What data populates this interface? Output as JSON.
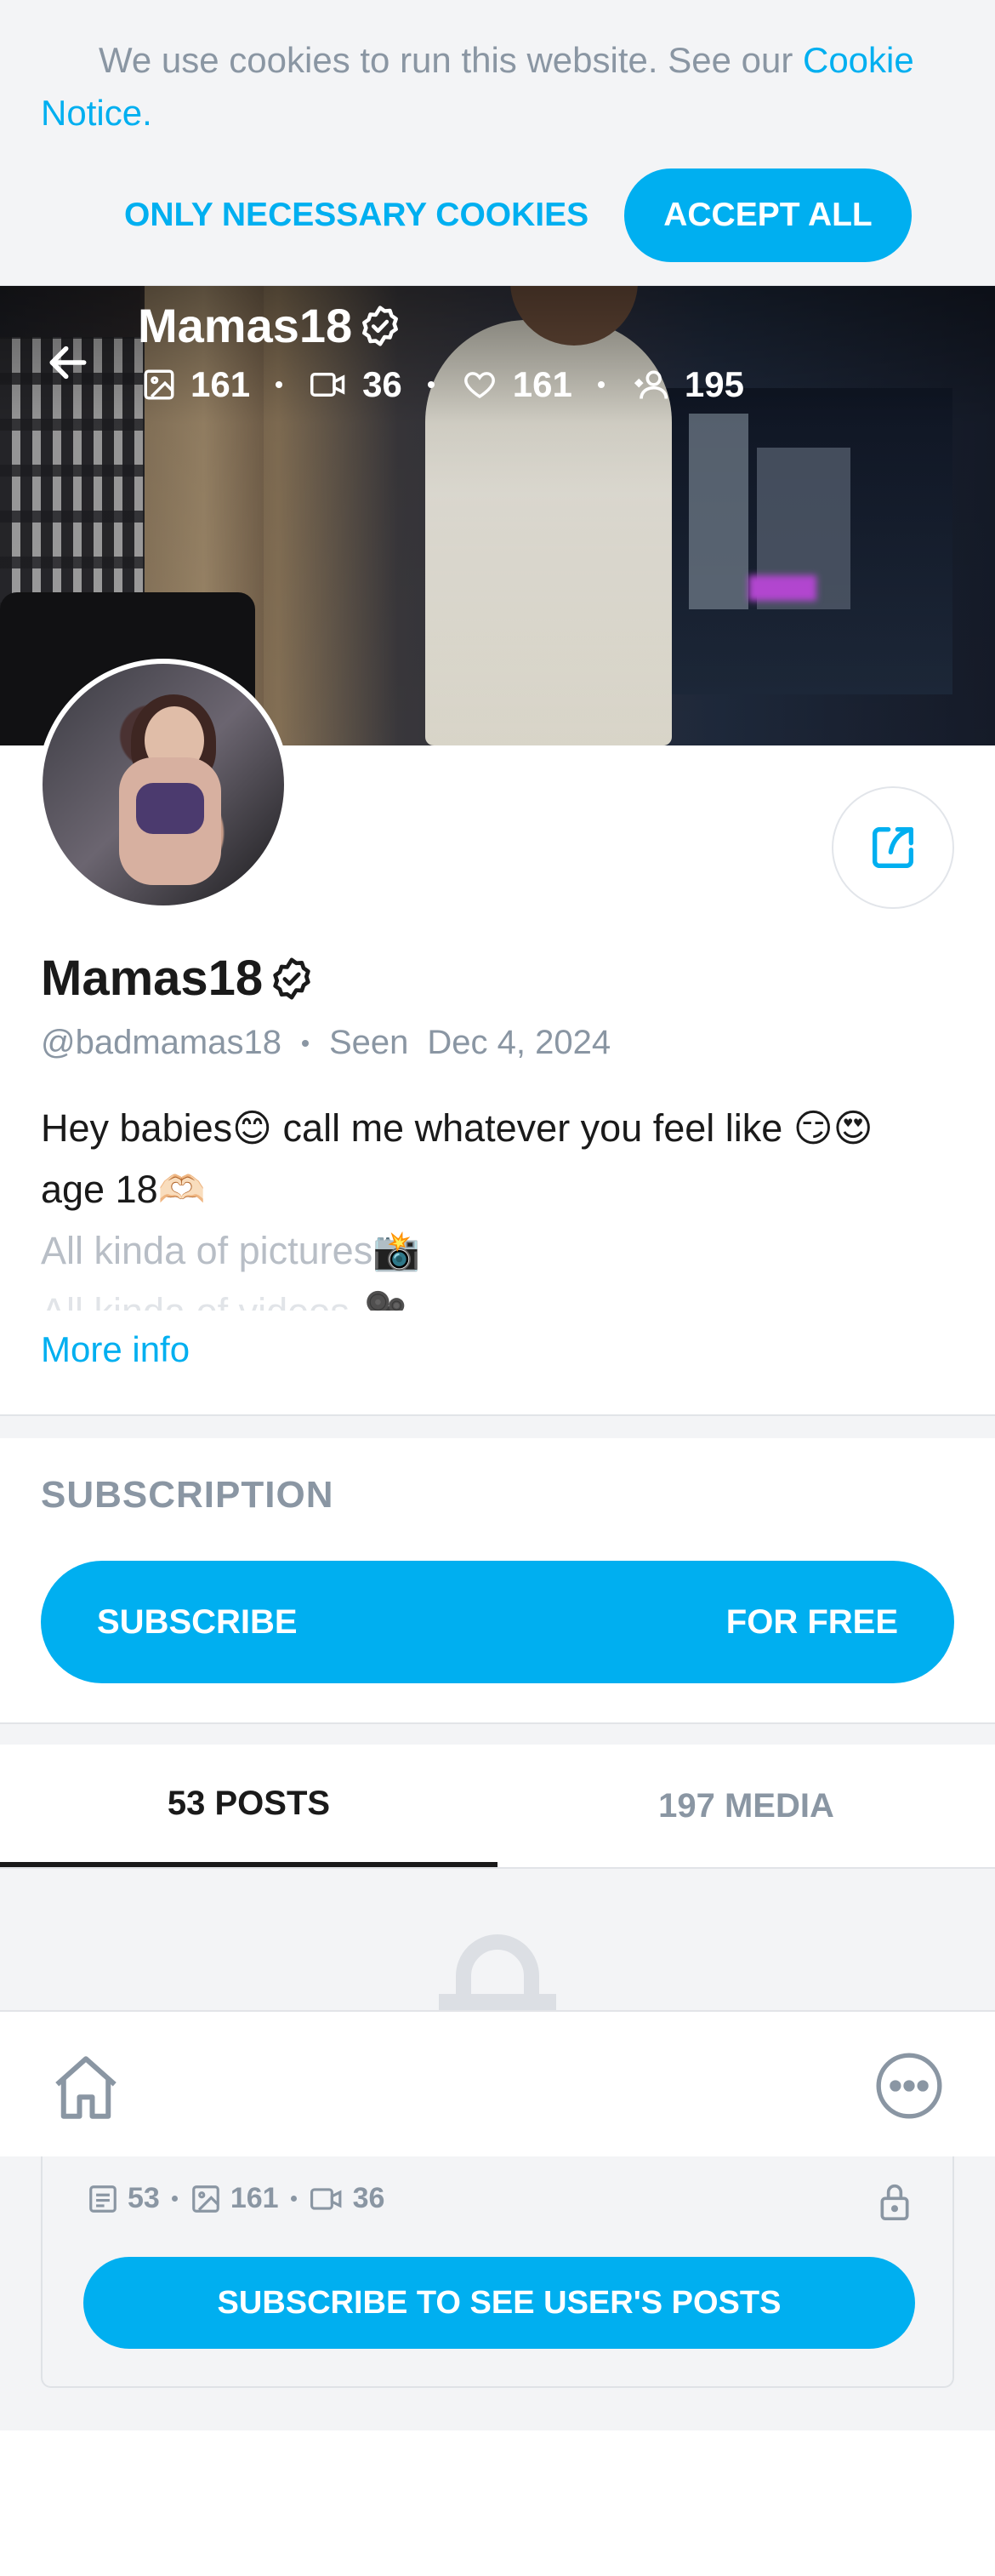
{
  "cookie": {
    "text": "We use cookies to run this website. See our ",
    "link": "Cookie Notice",
    "period": ".",
    "necessary_label": "ONLY NECESSARY COOKIES",
    "accept_label": "ACCEPT ALL"
  },
  "header": {
    "name": "Mamas18",
    "stats": {
      "photos": "161",
      "videos": "36",
      "likes": "161",
      "fans": "195"
    }
  },
  "profile": {
    "name": "Mamas18",
    "handle": "@badmamas18",
    "seen_label": "Seen",
    "seen_date": "Dec 4, 2024",
    "bio_line1": "Hey babies😊 call me whatever you feel like 😏😍",
    "bio_line2": "age 18🫶🏻",
    "bio_line3": "All kinda of pictures📸",
    "bio_line4": "All kinda of videos 🎥",
    "more_info": "More info"
  },
  "subscription": {
    "title": "SUBSCRIPTION",
    "button_left": "SUBSCRIBE",
    "button_right": "FOR FREE"
  },
  "tabs": [
    {
      "label": "53 POSTS"
    },
    {
      "label": "197 MEDIA"
    }
  ],
  "locked": {
    "posts": "53",
    "photos": "161",
    "videos": "36",
    "button": "SUBSCRIBE TO SEE USER'S POSTS"
  },
  "colors": {
    "accent": "#00aff0",
    "muted": "#8a96a3",
    "bg_gray": "#f3f4f6"
  }
}
